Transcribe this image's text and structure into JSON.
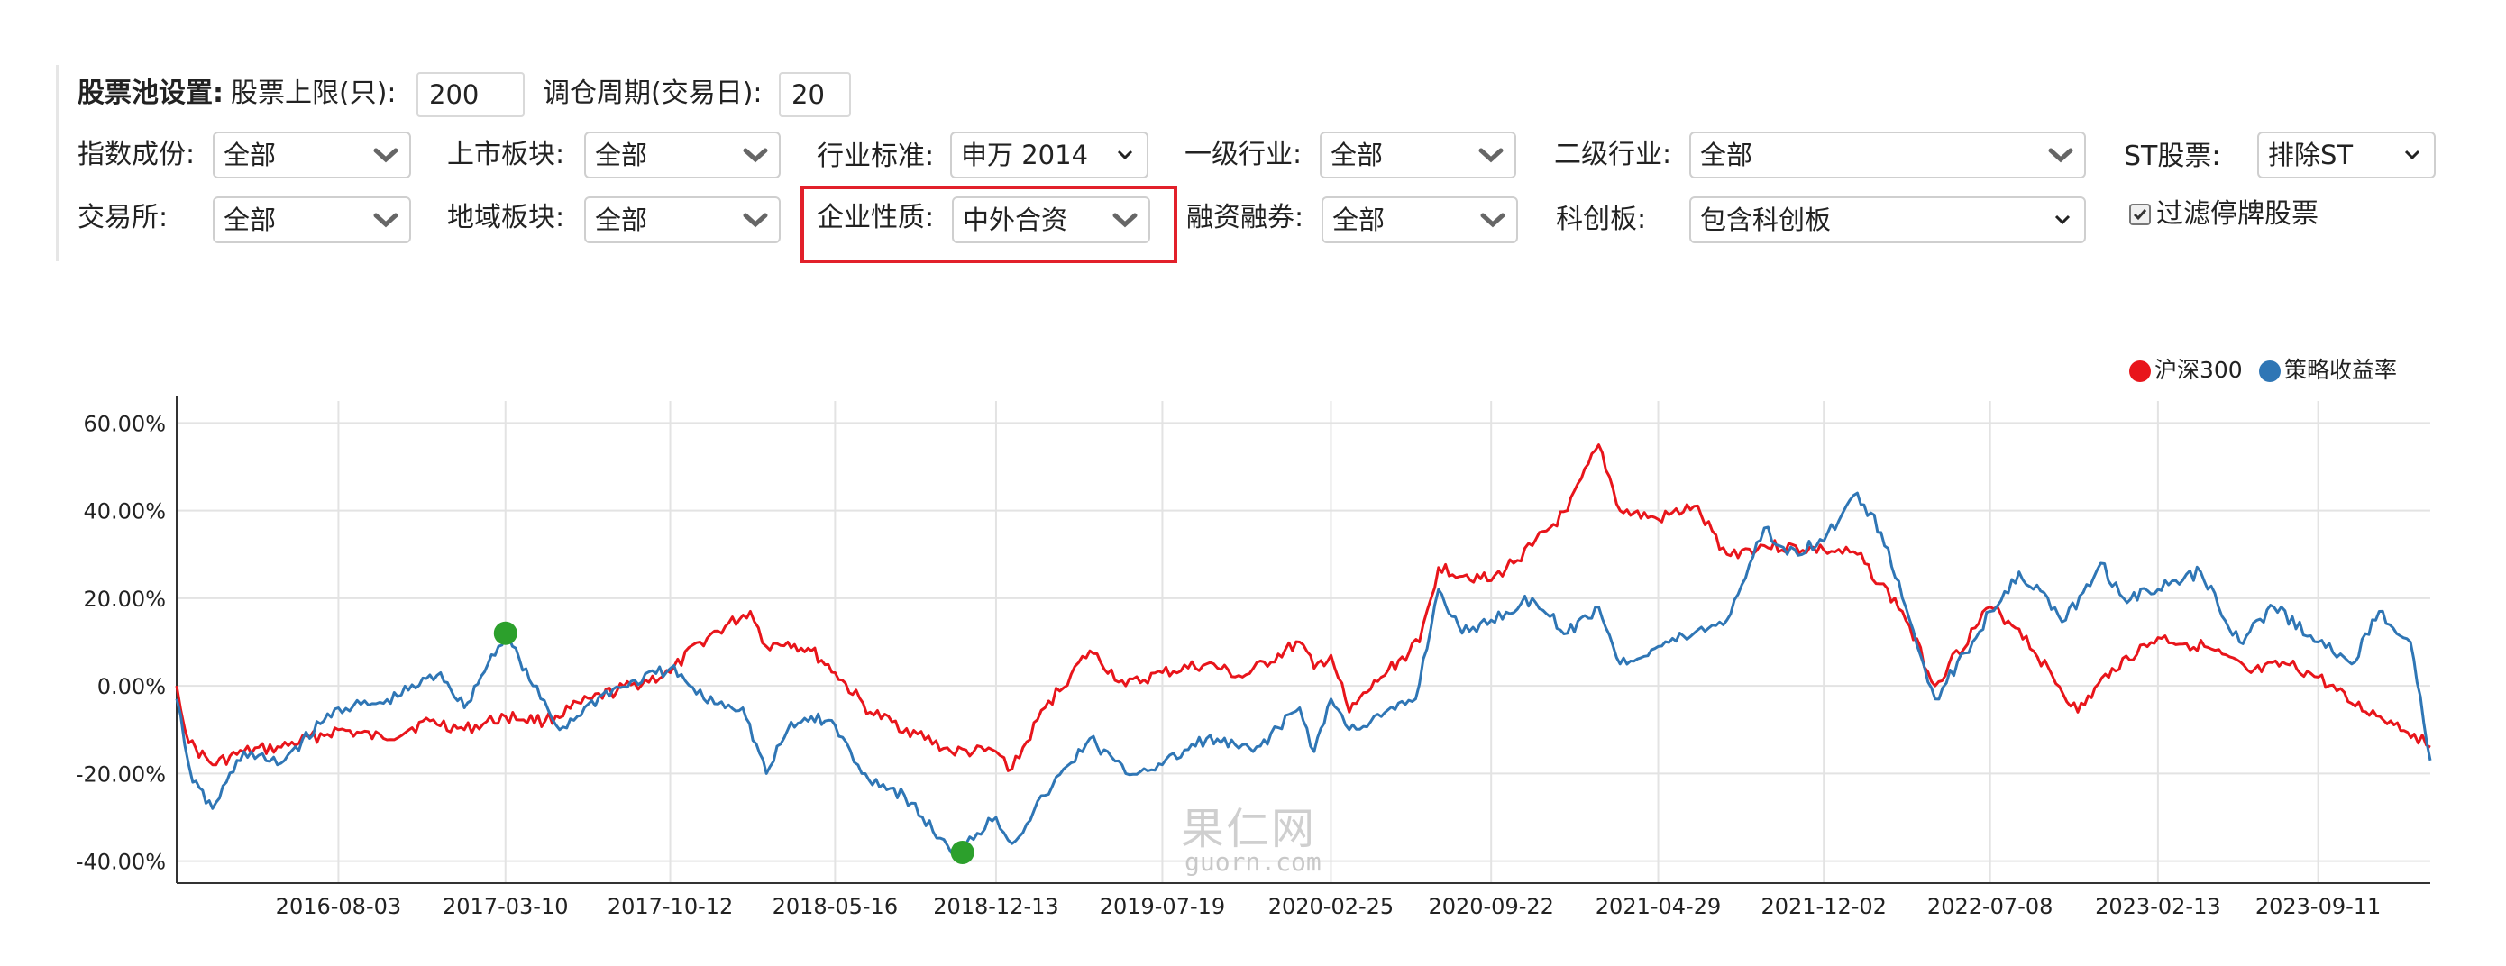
{
  "filters": {
    "pool_label": "股票池设置:",
    "max_stocks_label": "股票上限(只):",
    "max_stocks_value": "200",
    "rebalance_label": "调仓周期(交易日):",
    "rebalance_value": "20",
    "index_label": "指数成份:",
    "index_value": "全部",
    "board_label": "上市板块:",
    "board_value": "全部",
    "industry_std_label": "行业标准:",
    "industry_std_value": "申万 2014",
    "level1_label": "一级行业:",
    "level1_value": "全部",
    "level2_label": "二级行业:",
    "level2_value": "全部",
    "st_label": "ST股票:",
    "st_value": "排除ST",
    "exchange_label": "交易所:",
    "exchange_value": "全部",
    "region_label": "地域板块:",
    "region_value": "全部",
    "nature_label": "企业性质:",
    "nature_value": "中外合资",
    "margin_label": "融资融券:",
    "margin_value": "全部",
    "star_label": "科创板:",
    "star_value": "包含科创板",
    "suspend_label": "过滤停牌股票",
    "suspend_checked": true
  },
  "legend": {
    "hs300": "沪深300",
    "strategy": "策略收益率"
  },
  "colors": {
    "hs300": "#e8151b",
    "strategy": "#2f76b5",
    "marker": "#2ca02c",
    "highlight": "#e2202a"
  },
  "watermark": {
    "cn": "果仁网",
    "en": "guorn.com"
  },
  "chart_data": {
    "type": "line",
    "y_ticks": [
      "60.00%",
      "40.00%",
      "20.00%",
      "0.00%",
      "-20.00%",
      "-40.00%"
    ],
    "x_ticks": [
      "2016-08-03",
      "2017-03-10",
      "2017-10-12",
      "2018-05-16",
      "2018-12-13",
      "2019-07-19",
      "2020-02-25",
      "2020-09-22",
      "2021-04-29",
      "2021-12-02",
      "2022-07-08",
      "2023-02-13",
      "2023-09-11"
    ],
    "ylim": [
      -45,
      65
    ],
    "x_range": [
      "2016-01-04",
      "2024-02-05"
    ],
    "grid": true,
    "legend_position": "top-right",
    "series": [
      {
        "name": "沪深300",
        "color_key": "hs300",
        "points": [
          [
            "2016-01-04",
            0
          ],
          [
            "2016-01-20",
            -13
          ],
          [
            "2016-02-20",
            -18
          ],
          [
            "2016-04-01",
            -15
          ],
          [
            "2016-05-20",
            -14
          ],
          [
            "2016-08-03",
            -10
          ],
          [
            "2016-10-01",
            -12
          ],
          [
            "2016-12-01",
            -8
          ],
          [
            "2017-01-15",
            -10
          ],
          [
            "2017-03-10",
            -7
          ],
          [
            "2017-05-01",
            -8
          ],
          [
            "2017-07-01",
            -3
          ],
          [
            "2017-10-12",
            3
          ],
          [
            "2017-11-20",
            10
          ],
          [
            "2018-01-25",
            17
          ],
          [
            "2018-02-15",
            9
          ],
          [
            "2018-03-15",
            10
          ],
          [
            "2018-04-15",
            8
          ],
          [
            "2018-05-16",
            3
          ],
          [
            "2018-07-01",
            -6
          ],
          [
            "2018-09-01",
            -11
          ],
          [
            "2018-10-15",
            -15
          ],
          [
            "2018-12-13",
            -15
          ],
          [
            "2019-01-03",
            -19
          ],
          [
            "2019-02-15",
            -5
          ],
          [
            "2019-04-15",
            8
          ],
          [
            "2019-06-01",
            0
          ],
          [
            "2019-07-19",
            3
          ],
          [
            "2019-09-15",
            5
          ],
          [
            "2019-11-01",
            2
          ],
          [
            "2020-01-15",
            10
          ],
          [
            "2020-02-03",
            4
          ],
          [
            "2020-02-25",
            7
          ],
          [
            "2020-03-20",
            -6
          ],
          [
            "2020-05-01",
            2
          ],
          [
            "2020-06-20",
            10
          ],
          [
            "2020-07-15",
            27
          ],
          [
            "2020-09-22",
            24
          ],
          [
            "2020-11-15",
            32
          ],
          [
            "2020-12-31",
            40
          ],
          [
            "2021-02-10",
            55
          ],
          [
            "2021-03-10",
            40
          ],
          [
            "2021-04-29",
            38
          ],
          [
            "2021-06-15",
            41
          ],
          [
            "2021-07-28",
            30
          ],
          [
            "2021-09-15",
            32
          ],
          [
            "2021-12-02",
            31
          ],
          [
            "2022-01-15",
            30
          ],
          [
            "2022-03-15",
            17
          ],
          [
            "2022-04-27",
            0
          ],
          [
            "2022-05-15",
            5
          ],
          [
            "2022-07-08",
            18
          ],
          [
            "2022-08-15",
            13
          ],
          [
            "2022-10-31",
            -6
          ],
          [
            "2022-12-15",
            4
          ],
          [
            "2023-02-13",
            11
          ],
          [
            "2023-04-15",
            9
          ],
          [
            "2023-06-15",
            3
          ],
          [
            "2023-07-31",
            5
          ],
          [
            "2023-09-11",
            2
          ],
          [
            "2023-10-25",
            -4
          ],
          [
            "2023-12-15",
            -8
          ],
          [
            "2024-01-15",
            -11
          ],
          [
            "2024-02-05",
            -14
          ]
        ]
      },
      {
        "name": "策略收益率",
        "color_key": "strategy",
        "points": [
          [
            "2016-01-04",
            -3
          ],
          [
            "2016-01-25",
            -22
          ],
          [
            "2016-02-20",
            -28
          ],
          [
            "2016-04-01",
            -15
          ],
          [
            "2016-05-15",
            -18
          ],
          [
            "2016-07-15",
            -8
          ],
          [
            "2016-08-03",
            -5
          ],
          [
            "2016-10-01",
            -4
          ],
          [
            "2016-12-15",
            3
          ],
          [
            "2017-01-15",
            -5
          ],
          [
            "2017-02-15",
            5
          ],
          [
            "2017-03-10",
            12
          ],
          [
            "2017-04-15",
            0
          ],
          [
            "2017-05-20",
            -10
          ],
          [
            "2017-07-15",
            -2
          ],
          [
            "2017-10-12",
            4
          ],
          [
            "2017-11-25",
            -3
          ],
          [
            "2018-01-15",
            -5
          ],
          [
            "2018-02-15",
            -20
          ],
          [
            "2018-03-15",
            -10
          ],
          [
            "2018-04-15",
            -7
          ],
          [
            "2018-05-16",
            -9
          ],
          [
            "2018-06-20",
            -20
          ],
          [
            "2018-08-15",
            -25
          ],
          [
            "2018-10-15",
            -38
          ],
          [
            "2018-12-13",
            -30
          ],
          [
            "2019-01-03",
            -36
          ],
          [
            "2019-02-15",
            -25
          ],
          [
            "2019-04-15",
            -12
          ],
          [
            "2019-06-01",
            -20
          ],
          [
            "2019-07-19",
            -18
          ],
          [
            "2019-09-15",
            -12
          ],
          [
            "2019-11-15",
            -15
          ],
          [
            "2020-01-15",
            -5
          ],
          [
            "2020-02-03",
            -15
          ],
          [
            "2020-02-25",
            -3
          ],
          [
            "2020-03-20",
            -10
          ],
          [
            "2020-05-01",
            -7
          ],
          [
            "2020-06-15",
            -3
          ],
          [
            "2020-07-15",
            22
          ],
          [
            "2020-08-15",
            12
          ],
          [
            "2020-09-22",
            15
          ],
          [
            "2020-11-15",
            20
          ],
          [
            "2020-12-31",
            12
          ],
          [
            "2021-02-10",
            18
          ],
          [
            "2021-03-10",
            5
          ],
          [
            "2021-04-29",
            9
          ],
          [
            "2021-06-15",
            12
          ],
          [
            "2021-07-28",
            15
          ],
          [
            "2021-09-15",
            36
          ],
          [
            "2021-10-15",
            30
          ],
          [
            "2021-12-02",
            33
          ],
          [
            "2022-01-15",
            44
          ],
          [
            "2022-02-15",
            35
          ],
          [
            "2022-03-15",
            20
          ],
          [
            "2022-04-27",
            -3
          ],
          [
            "2022-06-15",
            10
          ],
          [
            "2022-07-08",
            17
          ],
          [
            "2022-08-15",
            26
          ],
          [
            "2022-10-15",
            15
          ],
          [
            "2022-11-30",
            28
          ],
          [
            "2022-12-30",
            20
          ],
          [
            "2023-02-13",
            22
          ],
          [
            "2023-04-10",
            26
          ],
          [
            "2023-05-31",
            10
          ],
          [
            "2023-07-15",
            18
          ],
          [
            "2023-09-11",
            10
          ],
          [
            "2023-10-25",
            5
          ],
          [
            "2023-11-30",
            17
          ],
          [
            "2024-01-10",
            10
          ],
          [
            "2024-02-05",
            -17
          ]
        ]
      }
    ],
    "markers": [
      [
        "2017-03-10",
        12
      ],
      [
        "2018-10-30",
        -38
      ]
    ]
  }
}
